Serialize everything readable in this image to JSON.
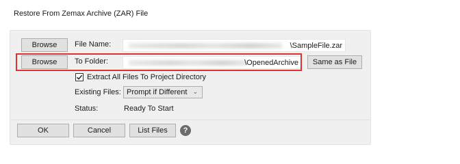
{
  "window": {
    "title": "Restore From Zemax Archive (ZAR) File"
  },
  "file_name": {
    "browse_label": "Browse",
    "label": "File Name:",
    "value": "\\SampleFile.zar"
  },
  "to_folder": {
    "browse_label": "Browse",
    "label": "To Folder:",
    "value": "\\OpenedArchive",
    "same_as_file_label": "Same as File",
    "highlight_color": "#e03131"
  },
  "extract_option": {
    "checked": true,
    "label": "Extract All Files To Project Directory"
  },
  "existing_files": {
    "label": "Existing Files:",
    "selected": "Prompt if Different"
  },
  "status": {
    "label": "Status:",
    "value": "Ready To Start"
  },
  "footer": {
    "ok_label": "OK",
    "cancel_label": "Cancel",
    "list_files_label": "List Files",
    "help_glyph": "?"
  },
  "icons": {
    "check": "check-icon",
    "chevron": "chevron-down-icon",
    "help": "help-icon"
  }
}
